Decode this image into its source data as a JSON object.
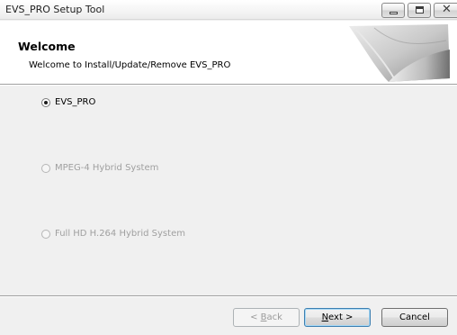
{
  "window": {
    "title": "EVS_PRO Setup Tool",
    "controls": {
      "minimize": "minimize",
      "maximize": "maximize",
      "close": "✕"
    }
  },
  "header": {
    "title": "Welcome",
    "subtitle": "Welcome to Install/Update/Remove EVS_PRO"
  },
  "options": [
    {
      "label": "EVS_PRO",
      "selected": true,
      "enabled": true
    },
    {
      "label": "MPEG-4 Hybrid System",
      "selected": false,
      "enabled": false
    },
    {
      "label": "Full HD H.264 Hybrid System",
      "selected": false,
      "enabled": false
    }
  ],
  "buttons": {
    "back": {
      "prefix": "< ",
      "accel": "B",
      "rest": "ack",
      "enabled": false
    },
    "next": {
      "accel": "N",
      "rest": "ext >",
      "enabled": true
    },
    "cancel": {
      "label": "Cancel",
      "enabled": true
    }
  }
}
